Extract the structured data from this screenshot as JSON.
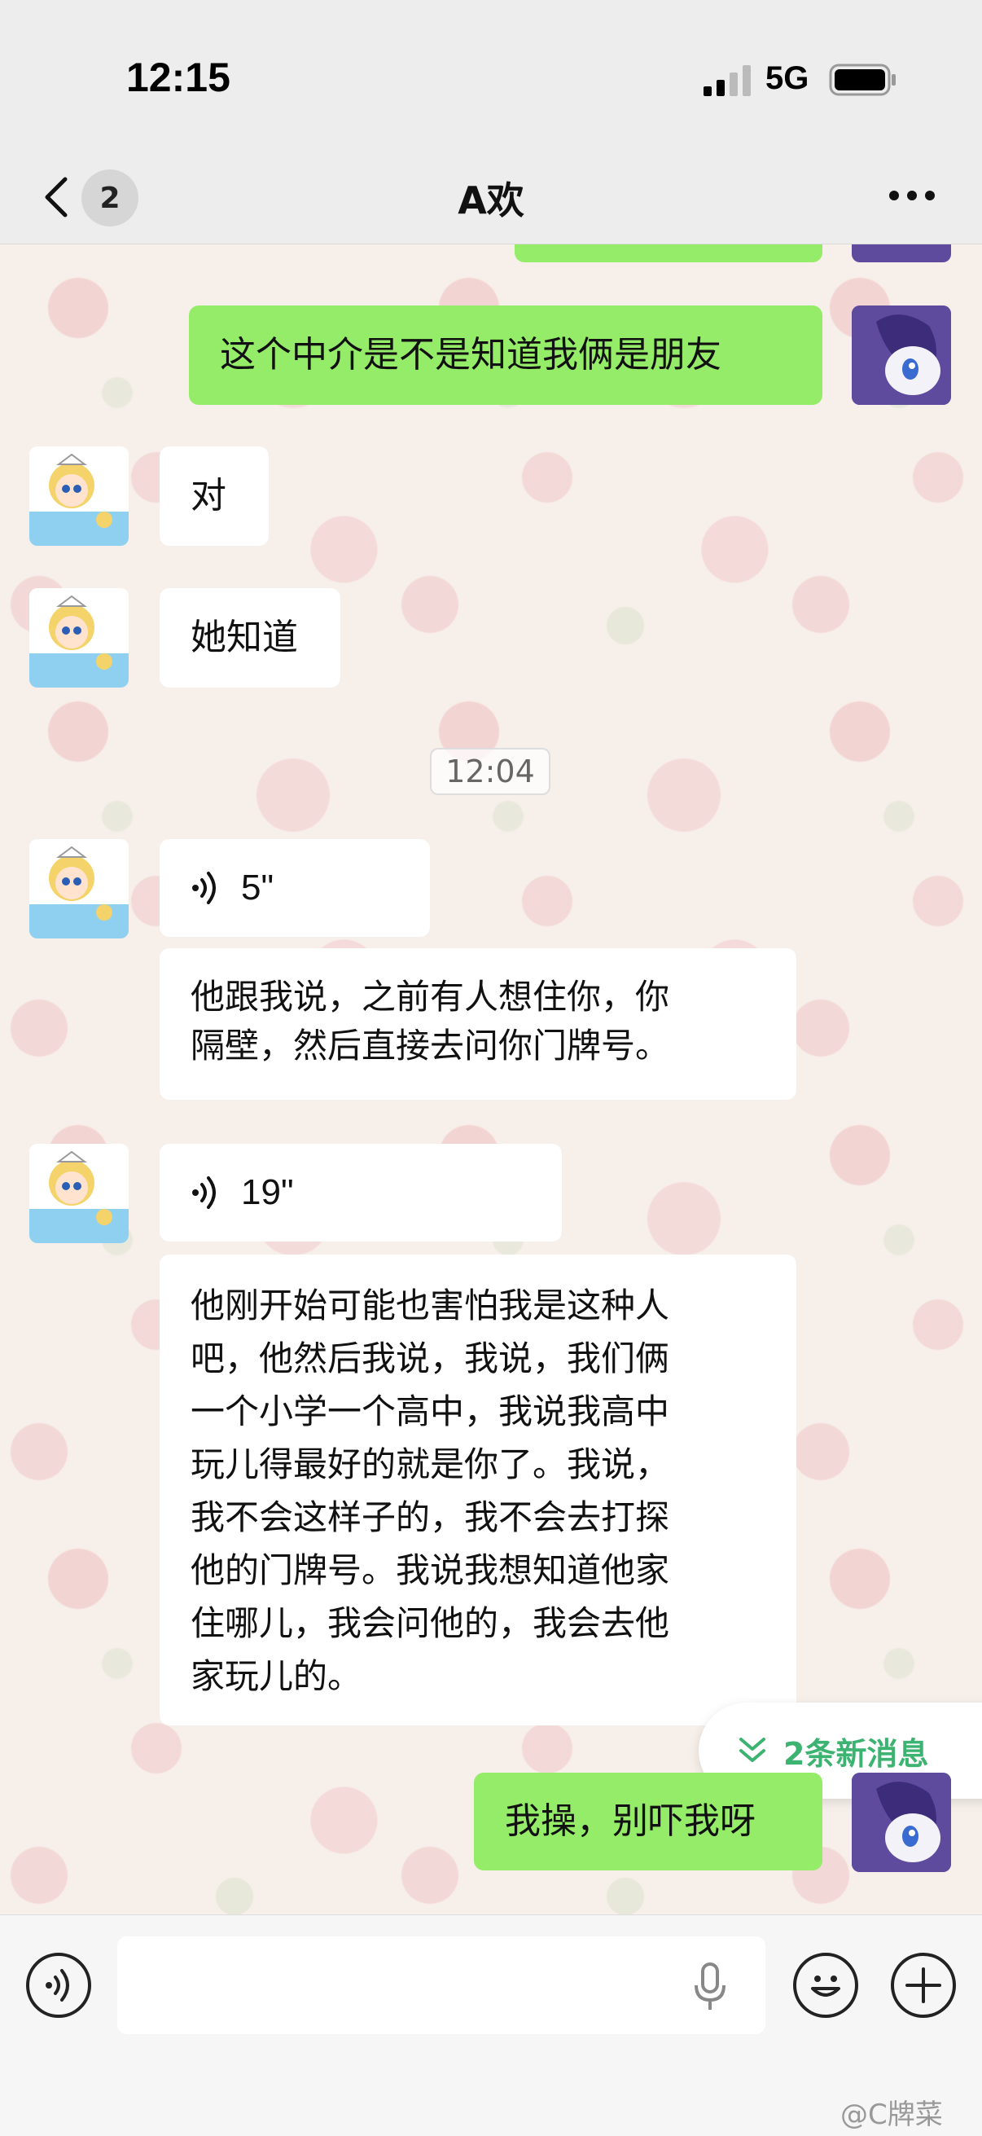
{
  "status_bar": {
    "time": "12:15",
    "network": "5G"
  },
  "nav": {
    "unread_count": "2",
    "title": "A欢"
  },
  "messages": [
    {
      "side": "out",
      "text": "这个中介是不是知道我俩是朋友"
    },
    {
      "side": "in",
      "text": "对"
    },
    {
      "side": "in",
      "text": "她知道"
    },
    {
      "side": "in",
      "voice_duration": "5\"",
      "transcript": [
        "他跟我说，之前有人想住你，你",
        "隔壁，然后直接去问你门牌号。"
      ]
    },
    {
      "side": "in",
      "voice_duration": "19\"",
      "transcript": [
        "他刚开始可能也害怕我是这种人",
        "吧，他然后我说，我说，我们俩",
        "一个小学一个高中，我说我高中",
        "玩儿得最好的就是你了。我说，",
        "我不会这样子的，我不会去打探",
        "他的门牌号。我说我想知道他家",
        "住哪儿，我会问他的，我会去他",
        "家玩儿的。"
      ]
    },
    {
      "side": "out",
      "text": "我操，别吓我呀"
    }
  ],
  "time_divider": "12:04",
  "new_messages_label": "2条新消息",
  "input": {
    "value": "",
    "placeholder": ""
  },
  "watermark": "@C牌菜",
  "colors": {
    "outgoing_bubble": "#95ec69",
    "incoming_bubble": "#ffffff",
    "new_msg_text": "#3cb371",
    "nav_bg": "#ededed"
  }
}
